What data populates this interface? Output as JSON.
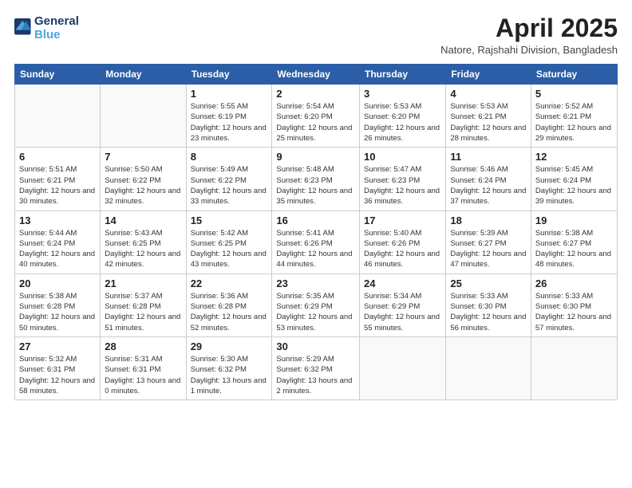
{
  "header": {
    "logo_line1": "General",
    "logo_line2": "Blue",
    "month_title": "April 2025",
    "location": "Natore, Rajshahi Division, Bangladesh"
  },
  "weekdays": [
    "Sunday",
    "Monday",
    "Tuesday",
    "Wednesday",
    "Thursday",
    "Friday",
    "Saturday"
  ],
  "weeks": [
    [
      {
        "num": "",
        "info": ""
      },
      {
        "num": "",
        "info": ""
      },
      {
        "num": "1",
        "info": "Sunrise: 5:55 AM\nSunset: 6:19 PM\nDaylight: 12 hours and 23 minutes."
      },
      {
        "num": "2",
        "info": "Sunrise: 5:54 AM\nSunset: 6:20 PM\nDaylight: 12 hours and 25 minutes."
      },
      {
        "num": "3",
        "info": "Sunrise: 5:53 AM\nSunset: 6:20 PM\nDaylight: 12 hours and 26 minutes."
      },
      {
        "num": "4",
        "info": "Sunrise: 5:53 AM\nSunset: 6:21 PM\nDaylight: 12 hours and 28 minutes."
      },
      {
        "num": "5",
        "info": "Sunrise: 5:52 AM\nSunset: 6:21 PM\nDaylight: 12 hours and 29 minutes."
      }
    ],
    [
      {
        "num": "6",
        "info": "Sunrise: 5:51 AM\nSunset: 6:21 PM\nDaylight: 12 hours and 30 minutes."
      },
      {
        "num": "7",
        "info": "Sunrise: 5:50 AM\nSunset: 6:22 PM\nDaylight: 12 hours and 32 minutes."
      },
      {
        "num": "8",
        "info": "Sunrise: 5:49 AM\nSunset: 6:22 PM\nDaylight: 12 hours and 33 minutes."
      },
      {
        "num": "9",
        "info": "Sunrise: 5:48 AM\nSunset: 6:23 PM\nDaylight: 12 hours and 35 minutes."
      },
      {
        "num": "10",
        "info": "Sunrise: 5:47 AM\nSunset: 6:23 PM\nDaylight: 12 hours and 36 minutes."
      },
      {
        "num": "11",
        "info": "Sunrise: 5:46 AM\nSunset: 6:24 PM\nDaylight: 12 hours and 37 minutes."
      },
      {
        "num": "12",
        "info": "Sunrise: 5:45 AM\nSunset: 6:24 PM\nDaylight: 12 hours and 39 minutes."
      }
    ],
    [
      {
        "num": "13",
        "info": "Sunrise: 5:44 AM\nSunset: 6:24 PM\nDaylight: 12 hours and 40 minutes."
      },
      {
        "num": "14",
        "info": "Sunrise: 5:43 AM\nSunset: 6:25 PM\nDaylight: 12 hours and 42 minutes."
      },
      {
        "num": "15",
        "info": "Sunrise: 5:42 AM\nSunset: 6:25 PM\nDaylight: 12 hours and 43 minutes."
      },
      {
        "num": "16",
        "info": "Sunrise: 5:41 AM\nSunset: 6:26 PM\nDaylight: 12 hours and 44 minutes."
      },
      {
        "num": "17",
        "info": "Sunrise: 5:40 AM\nSunset: 6:26 PM\nDaylight: 12 hours and 46 minutes."
      },
      {
        "num": "18",
        "info": "Sunrise: 5:39 AM\nSunset: 6:27 PM\nDaylight: 12 hours and 47 minutes."
      },
      {
        "num": "19",
        "info": "Sunrise: 5:38 AM\nSunset: 6:27 PM\nDaylight: 12 hours and 48 minutes."
      }
    ],
    [
      {
        "num": "20",
        "info": "Sunrise: 5:38 AM\nSunset: 6:28 PM\nDaylight: 12 hours and 50 minutes."
      },
      {
        "num": "21",
        "info": "Sunrise: 5:37 AM\nSunset: 6:28 PM\nDaylight: 12 hours and 51 minutes."
      },
      {
        "num": "22",
        "info": "Sunrise: 5:36 AM\nSunset: 6:28 PM\nDaylight: 12 hours and 52 minutes."
      },
      {
        "num": "23",
        "info": "Sunrise: 5:35 AM\nSunset: 6:29 PM\nDaylight: 12 hours and 53 minutes."
      },
      {
        "num": "24",
        "info": "Sunrise: 5:34 AM\nSunset: 6:29 PM\nDaylight: 12 hours and 55 minutes."
      },
      {
        "num": "25",
        "info": "Sunrise: 5:33 AM\nSunset: 6:30 PM\nDaylight: 12 hours and 56 minutes."
      },
      {
        "num": "26",
        "info": "Sunrise: 5:33 AM\nSunset: 6:30 PM\nDaylight: 12 hours and 57 minutes."
      }
    ],
    [
      {
        "num": "27",
        "info": "Sunrise: 5:32 AM\nSunset: 6:31 PM\nDaylight: 12 hours and 58 minutes."
      },
      {
        "num": "28",
        "info": "Sunrise: 5:31 AM\nSunset: 6:31 PM\nDaylight: 13 hours and 0 minutes."
      },
      {
        "num": "29",
        "info": "Sunrise: 5:30 AM\nSunset: 6:32 PM\nDaylight: 13 hours and 1 minute."
      },
      {
        "num": "30",
        "info": "Sunrise: 5:29 AM\nSunset: 6:32 PM\nDaylight: 13 hours and 2 minutes."
      },
      {
        "num": "",
        "info": ""
      },
      {
        "num": "",
        "info": ""
      },
      {
        "num": "",
        "info": ""
      }
    ]
  ]
}
